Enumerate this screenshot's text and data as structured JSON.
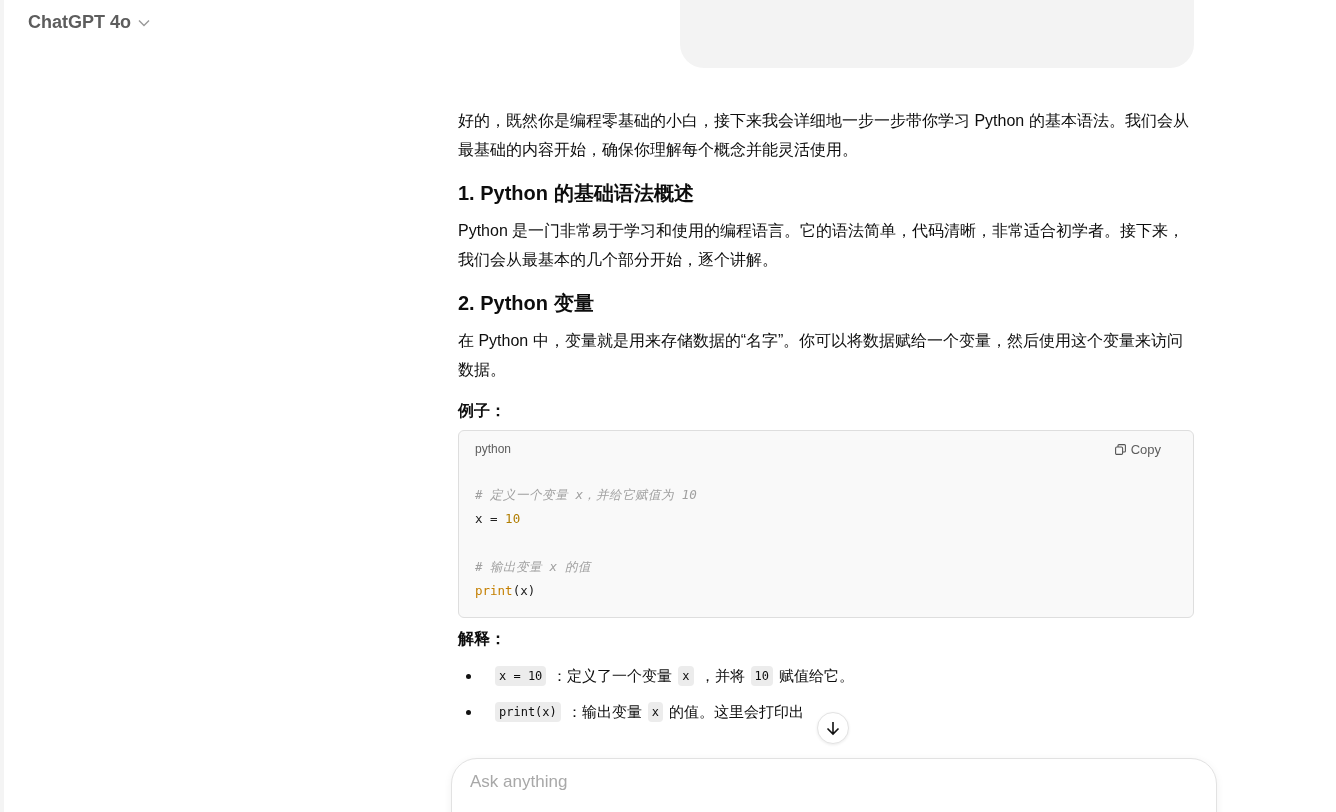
{
  "header": {
    "model": "ChatGPT 4o"
  },
  "user_bubble": {
    "kind": "bubble"
  },
  "answer": [
    {
      "kind": "paragraph",
      "text": "好的，既然你是编程零基础的小白，接下来我会详细地一步一步带你学习 Python 的基本语法。我们会从最基础的内容开始，确保你理解每个概念并能灵活使用。"
    },
    {
      "kind": "heading",
      "text": "1. Python 的基础语法概述"
    },
    {
      "kind": "paragraph",
      "text": "Python 是一门非常易于学习和使用的编程语言。它的语法简单，代码清晰，非常适合初学者。接下来，我们会从最基本的几个部分开始，逐个讲解。"
    },
    {
      "kind": "heading",
      "text": "2. Python 变量"
    },
    {
      "kind": "paragraph",
      "text": "在 Python 中，变量就是用来存储数据的“名字”。你可以将数据赋给一个变量，然后使用这个变量来访问数据。"
    },
    {
      "kind": "label",
      "text": "例子："
    },
    {
      "kind": "code",
      "language": "python",
      "copy": "Copy",
      "lines": [
        {
          "kind": "code",
          "segments": [
            {
              "kind": "comment",
              "text": "# 定义一个变量 x，并给它赋值为 10"
            }
          ]
        },
        {
          "kind": "code",
          "segments": [
            {
              "kind": "plain",
              "text": "x = "
            },
            {
              "kind": "number",
              "text": "10"
            }
          ]
        },
        {
          "kind": "blank"
        },
        {
          "kind": "code",
          "segments": [
            {
              "kind": "comment",
              "text": "# 输出变量 x 的值"
            }
          ]
        },
        {
          "kind": "code",
          "segments": [
            {
              "kind": "func",
              "text": "print"
            },
            {
              "kind": "plain",
              "text": "(x)"
            }
          ]
        }
      ]
    },
    {
      "kind": "label",
      "text": "解释："
    },
    {
      "kind": "list",
      "items": [
        [
          {
            "kind": "code",
            "text": "x = 10"
          },
          {
            "kind": "text",
            "text": "：定义了一个变量"
          },
          {
            "kind": "code",
            "text": "x"
          },
          {
            "kind": "text",
            "text": "，并将"
          },
          {
            "kind": "code",
            "text": "10"
          },
          {
            "kind": "text",
            "text": "赋值给它。"
          }
        ],
        [
          {
            "kind": "code",
            "text": "print(x)"
          },
          {
            "kind": "text",
            "text": "：输出变量"
          },
          {
            "kind": "code",
            "text": "x"
          },
          {
            "kind": "text",
            "text": "的值。这里会打印出"
          }
        ]
      ]
    }
  ],
  "composer": {
    "placeholder": "Ask anything"
  }
}
